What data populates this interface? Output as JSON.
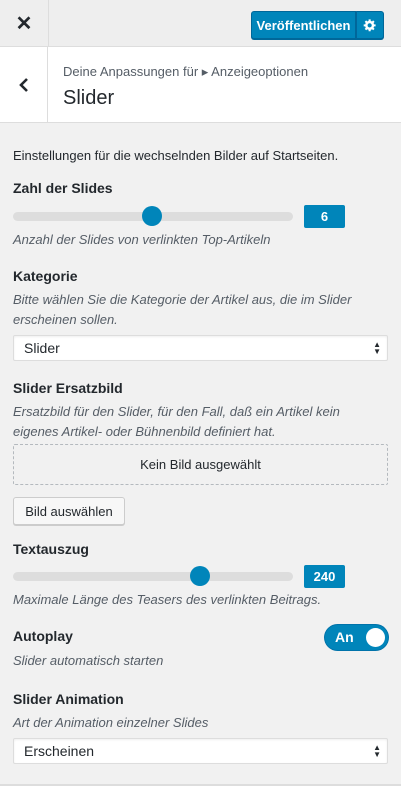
{
  "header": {
    "close_icon": "close-icon",
    "publish_label": "Veröffentlichen",
    "gear_icon": "gear-icon"
  },
  "section": {
    "breadcrumb": "Deine Anpassungen für ▸ Anzeigeoptionen",
    "title": "Slider"
  },
  "intro": "Einstellungen für die wechselnden Bilder auf Startseiten.",
  "slides_count": {
    "title": "Zahl der Slides",
    "value": "6",
    "fraction": 0.5,
    "description": "Anzahl der Slides von verlinkten Top-Artikeln"
  },
  "category": {
    "title": "Kategorie",
    "description_line1": "Bitte wählen Sie die Kategorie der Artikel aus, die im Slider",
    "description_line2": "erscheinen sollen.",
    "selected": "Slider"
  },
  "fallback_image": {
    "title": "Slider Ersatzbild",
    "description_line1": "Ersatzbild für den Slider, für den Fall, daß ein Artikel kein",
    "description_line2": "eigenes Artikel- oder Bühnenbild definiert hat.",
    "placeholder": "Kein Bild ausgewählt",
    "button_label": "Bild auswählen"
  },
  "excerpt": {
    "title": "Textauszug",
    "value": "240",
    "fraction": 0.67,
    "description": "Maximale Länge des Teasers des verlinkten Beitrags."
  },
  "autoplay": {
    "title": "Autoplay",
    "toggle_label": "An",
    "enabled": true,
    "description": "Slider automatisch starten"
  },
  "animation": {
    "title": "Slider Animation",
    "description": "Art der Animation einzelner Slides",
    "selected": "Erscheinen"
  },
  "colors": {
    "accent": "#0085ba",
    "track": "#dddddd"
  }
}
